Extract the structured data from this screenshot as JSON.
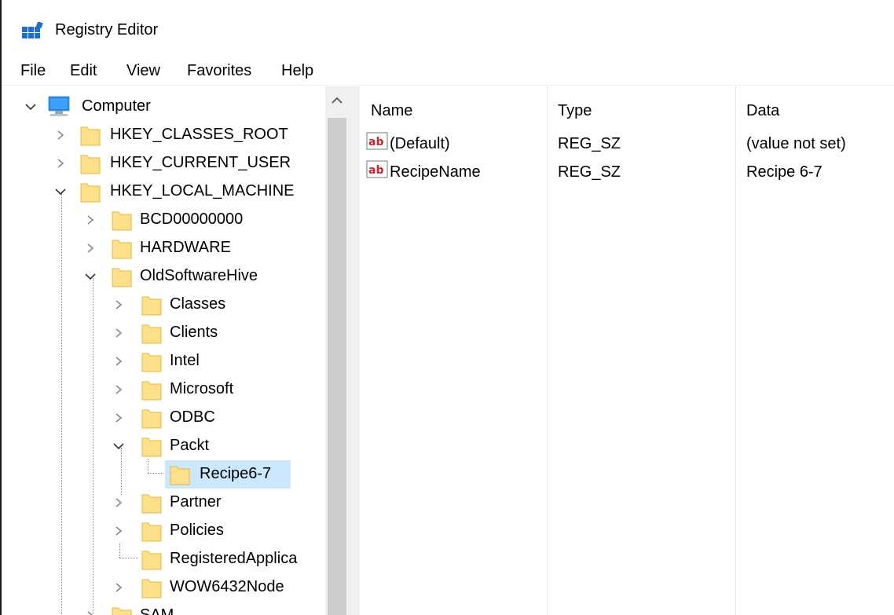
{
  "window": {
    "title": "Registry Editor"
  },
  "menu": [
    "File",
    "Edit",
    "View",
    "Favorites",
    "Help"
  ],
  "tree": {
    "root": "Computer",
    "hkeys": [
      "HKEY_CLASSES_ROOT",
      "HKEY_CURRENT_USER",
      "HKEY_LOCAL_MACHINE"
    ],
    "hklm_children": [
      "BCD00000000",
      "HARDWARE",
      "OldSoftwareHive"
    ],
    "oldsoftware_children": [
      "Classes",
      "Clients",
      "Intel",
      "Microsoft",
      "ODBC",
      "Packt"
    ],
    "packt_children": [
      "Recipe6-7"
    ],
    "after_packt": [
      "Partner",
      "Policies",
      "RegisteredApplica",
      "WOW6432Node"
    ],
    "next_hklm": "SAM",
    "selected": "Recipe6-7"
  },
  "values_table": {
    "columns": [
      "Name",
      "Type",
      "Data"
    ],
    "rows": [
      {
        "name": "(Default)",
        "type": "REG_SZ",
        "data": "(value not set)"
      },
      {
        "name": "RecipeName",
        "type": "REG_SZ",
        "data": "Recipe 6-7"
      }
    ]
  },
  "colors": {
    "selection": "#cce8ff",
    "folder": "#ffe08a",
    "accent": "#0078d7"
  }
}
